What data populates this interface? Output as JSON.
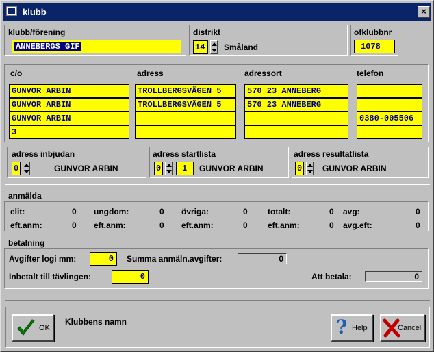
{
  "window": {
    "title": "klubb",
    "close_glyph": "×"
  },
  "club": {
    "label": "klubb/förening",
    "value": "ANNEBERGS GIF"
  },
  "district": {
    "label": "distrikt",
    "number": "14",
    "name": "Småland"
  },
  "ofklubbnr": {
    "label": "ofklubbnr",
    "value": "1078"
  },
  "contact": {
    "headers": {
      "co": "c/o",
      "adress": "adress",
      "adressort": "adressort",
      "telefon": "telefon"
    },
    "co": [
      "GUNVOR ARBIN",
      "GUNVOR ARBIN",
      "GUNVOR ARBIN",
      "3"
    ],
    "adress": [
      "TROLLBERGSVÄGEN 5",
      "TROLLBERGSVÄGEN 5",
      "",
      ""
    ],
    "adressort": [
      "570 23 ANNEBERG",
      "570 23 ANNEBERG",
      "",
      ""
    ],
    "telefon": [
      "",
      "",
      "0380-005506",
      ""
    ]
  },
  "inbjudan": {
    "label": "adress inbjudan",
    "num": "0",
    "name": "GUNVOR ARBIN"
  },
  "startlista": {
    "label": "adress startlista",
    "num": "0",
    "num2": "1",
    "name": "GUNVOR ARBIN"
  },
  "resultatlista": {
    "label": "adress resultatlista",
    "num": "0",
    "name": "GUNVOR ARBIN"
  },
  "anmalda": {
    "label": "anmälda",
    "row1": {
      "elit_l": "elit:",
      "elit_v": "0",
      "ungdom_l": "ungdom:",
      "ungdom_v": "0",
      "ovriga_l": "övriga:",
      "ovriga_v": "0",
      "totalt_l": "totalt:",
      "totalt_v": "0",
      "avg_l": "avg:",
      "avg_v": "0"
    },
    "row2": {
      "l1": "eft.anm:",
      "v1": "0",
      "l2": "eft.anm:",
      "v2": "0",
      "l3": "eft.anm:",
      "v3": "0",
      "l4": "eft.anm:",
      "v4": "0",
      "l5": "avg.eft:",
      "v5": "0"
    }
  },
  "betalning": {
    "label": "betalning",
    "logi_label": "Avgifter logi mm:",
    "logi_value": "0",
    "summa_label": "Summa anmäln.avgifter:",
    "summa_value": "0",
    "inbetalt_label": "Inbetalt till tävlingen:",
    "inbetalt_value": "0",
    "att_betala_label": "Att betala:",
    "att_betala_value": "0"
  },
  "footer": {
    "ok_label": "OK",
    "status_text": "Klubbens namn",
    "help_label": "Help",
    "cancel_label": "Cancel"
  },
  "colors": {
    "field": "#ffff00",
    "field_text": "#000080",
    "title": "#0a246a",
    "check": "#008000",
    "cross": "#c00000"
  }
}
